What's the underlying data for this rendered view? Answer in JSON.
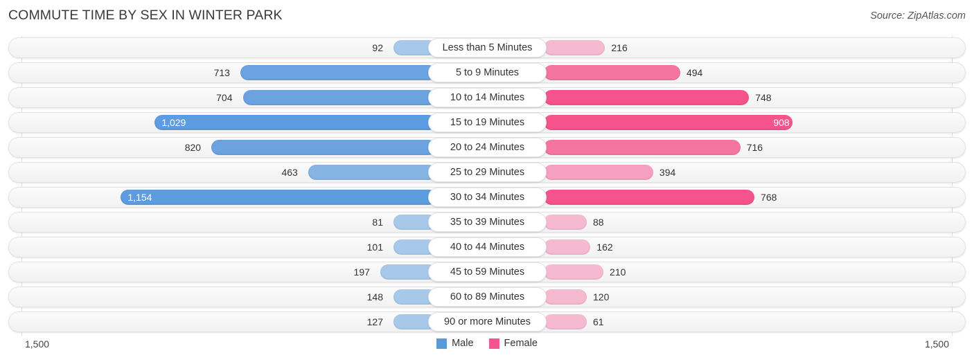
{
  "header": {
    "title": "COMMUTE TIME BY SEX IN WINTER PARK",
    "source": "Source: ZipAtlas.com"
  },
  "axis": {
    "left_label": "1,500",
    "right_label": "1,500",
    "max": 1500
  },
  "legend": {
    "items": [
      {
        "label": "Male",
        "color": "#5b9bd5"
      },
      {
        "label": "Female",
        "color": "#f2568f"
      }
    ]
  },
  "colors": {
    "male_light": "#a8c8ea",
    "male_mid": "#85b4e3",
    "male_strong": "#6aa3e0",
    "male_vivid": "#5d9ce0",
    "female_light": "#f5b9d0",
    "female_mid": "#f5a0c0",
    "female_strong": "#f4759f",
    "female_vivid": "#f4538c"
  },
  "chart_data": {
    "type": "bar",
    "orientation": "horizontal-diverging",
    "title": "COMMUTE TIME BY SEX IN WINTER PARK",
    "xlabel": "",
    "ylabel": "",
    "xlim": [
      1500,
      1500
    ],
    "grid": true,
    "legend_position": "bottom-center",
    "categories": [
      "Less than 5 Minutes",
      "5 to 9 Minutes",
      "10 to 14 Minutes",
      "15 to 19 Minutes",
      "20 to 24 Minutes",
      "25 to 29 Minutes",
      "30 to 34 Minutes",
      "35 to 39 Minutes",
      "40 to 44 Minutes",
      "45 to 59 Minutes",
      "60 to 89 Minutes",
      "90 or more Minutes"
    ],
    "series": [
      {
        "name": "Male",
        "direction": "left",
        "values": [
          92,
          713,
          704,
          1029,
          820,
          463,
          1154,
          81,
          101,
          197,
          148,
          127
        ],
        "labels": [
          "92",
          "713",
          "704",
          "1,029",
          "820",
          "463",
          "1,154",
          "81",
          "101",
          "197",
          "148",
          "127"
        ]
      },
      {
        "name": "Female",
        "direction": "right",
        "values": [
          216,
          494,
          748,
          908,
          716,
          394,
          768,
          88,
          162,
          210,
          120,
          61
        ],
        "labels": [
          "216",
          "494",
          "748",
          "908",
          "716",
          "394",
          "768",
          "88",
          "162",
          "210",
          "120",
          "61"
        ]
      }
    ]
  },
  "rows": [
    {
      "label": "Less than 5 Minutes",
      "male": "92",
      "female": "216",
      "male_tone": "light",
      "female_tone": "light",
      "male_inside": false,
      "female_inside": false
    },
    {
      "label": "5 to 9 Minutes",
      "male": "713",
      "female": "494",
      "male_tone": "strong",
      "female_tone": "strong",
      "male_inside": false,
      "female_inside": false
    },
    {
      "label": "10 to 14 Minutes",
      "male": "704",
      "female": "748",
      "male_tone": "strong",
      "female_tone": "vivid",
      "male_inside": false,
      "female_inside": false
    },
    {
      "label": "15 to 19 Minutes",
      "male": "1,029",
      "female": "908",
      "male_tone": "vivid",
      "female_tone": "vivid",
      "male_inside": true,
      "female_inside": true
    },
    {
      "label": "20 to 24 Minutes",
      "male": "820",
      "female": "716",
      "male_tone": "strong",
      "female_tone": "strong",
      "male_inside": false,
      "female_inside": false
    },
    {
      "label": "25 to 29 Minutes",
      "male": "463",
      "female": "394",
      "male_tone": "mid",
      "female_tone": "mid",
      "male_inside": false,
      "female_inside": false
    },
    {
      "label": "30 to 34 Minutes",
      "male": "1,154",
      "female": "768",
      "male_tone": "vivid",
      "female_tone": "vivid",
      "male_inside": true,
      "female_inside": false
    },
    {
      "label": "35 to 39 Minutes",
      "male": "81",
      "female": "88",
      "male_tone": "light",
      "female_tone": "light",
      "male_inside": false,
      "female_inside": false
    },
    {
      "label": "40 to 44 Minutes",
      "male": "101",
      "female": "162",
      "male_tone": "light",
      "female_tone": "light",
      "male_inside": false,
      "female_inside": false
    },
    {
      "label": "45 to 59 Minutes",
      "male": "197",
      "female": "210",
      "male_tone": "light",
      "female_tone": "light",
      "male_inside": false,
      "female_inside": false
    },
    {
      "label": "60 to 89 Minutes",
      "male": "148",
      "female": "120",
      "male_tone": "light",
      "female_tone": "light",
      "male_inside": false,
      "female_inside": false
    },
    {
      "label": "90 or more Minutes",
      "male": "127",
      "female": "61",
      "male_tone": "light",
      "female_tone": "light",
      "male_inside": false,
      "female_inside": false
    }
  ]
}
